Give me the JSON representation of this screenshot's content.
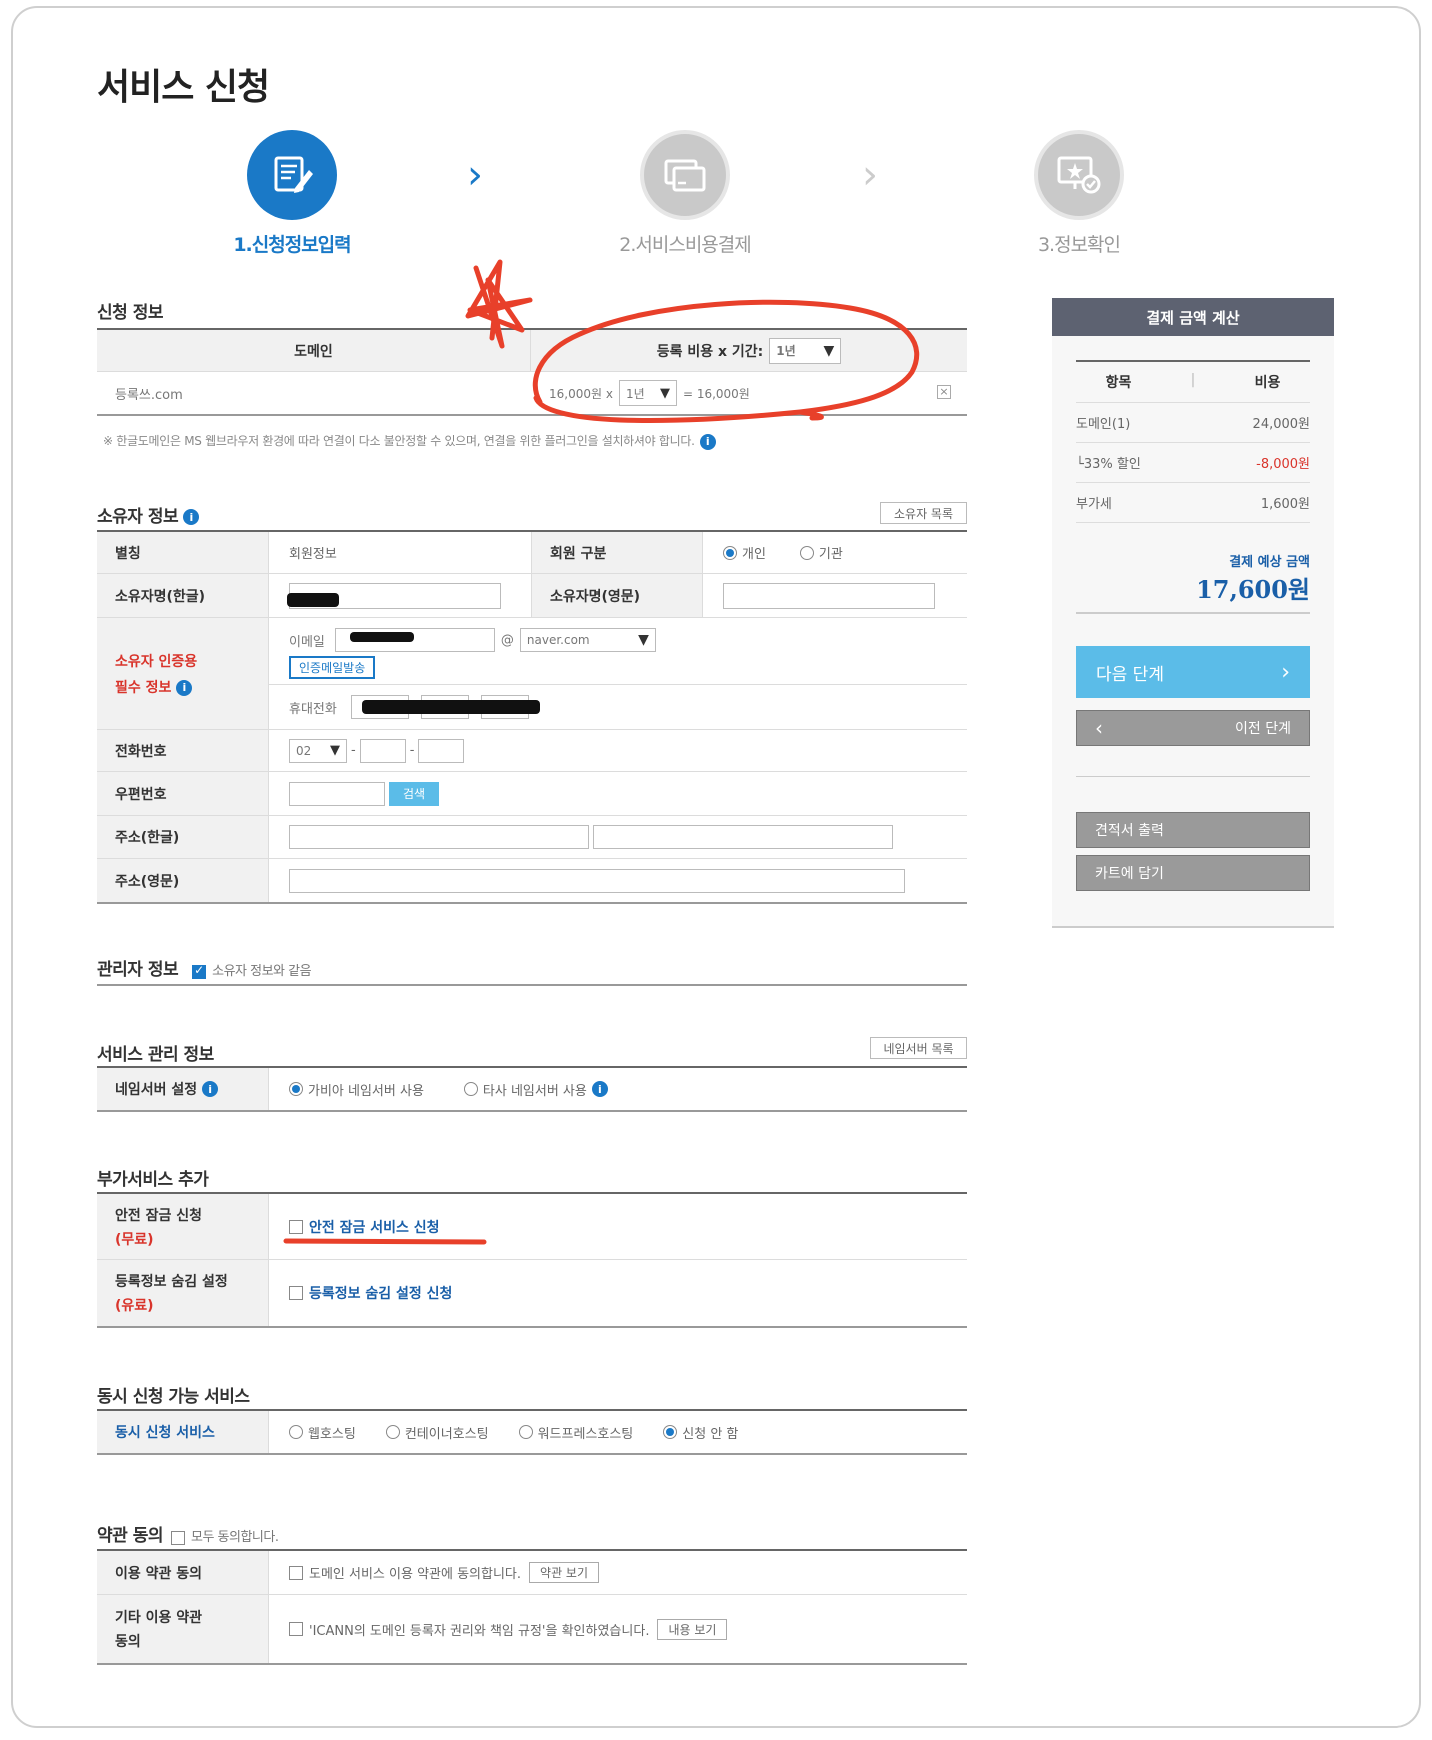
{
  "page_title": "서비스 신청",
  "steps": [
    {
      "label": "1.신청정보입력"
    },
    {
      "label": "2.서비스비용결제"
    },
    {
      "label": "3.정보확인"
    }
  ],
  "application": {
    "title": "신청 정보",
    "col_domain": "도메인",
    "col_fee": "등록 비용 x 기간:",
    "period_header_value": "1년",
    "domain_value": "등록쓰.com",
    "fee_text": "16,000원 x",
    "period_value": "1년",
    "total_text": "= 16,000원",
    "remove_icon": "×",
    "notice": "※ 한글도메인은 MS 웹브라우저 환경에 따라 연결이 다소 불안정할 수 있으며, 연결을 위한 플러그인을 설치하셔야 합니다."
  },
  "owner": {
    "title": "소유자 정보",
    "list_button": "소유자 목록",
    "nickname_label": "별칭",
    "nickname_value": "회원정보",
    "member_type_label": "회원 구분",
    "type_personal": "개인",
    "type_org": "기관",
    "name_ko_label": "소유자명(한글)",
    "name_en_label": "소유자명(영문)",
    "auth_label_1": "소유자 인증용",
    "auth_label_2": "필수 정보",
    "email_label": "이메일",
    "email_at": "@",
    "email_domain": "naver.com",
    "verify_button": "인증메일발송",
    "mobile_label": "휴대전화",
    "phone_label": "전화번호",
    "phone_prefix": "02",
    "dash": "-",
    "zip_label": "우편번호",
    "zip_button": "검색",
    "addr_ko_label": "주소(한글)",
    "addr_en_label": "주소(영문)"
  },
  "admin": {
    "title": "관리자 정보",
    "same_as_owner": "소유자 정보와 같음"
  },
  "service_mgmt": {
    "title": "서비스 관리 정보",
    "ns_list_button": "네임서버 목록",
    "ns_label": "네임서버 설정",
    "ns_gabia": "가비아 네임서버 사용",
    "ns_other": "타사 네임서버 사용"
  },
  "addons": {
    "title": "부가서비스 추가",
    "lock_label_1": "안전 잠금 신청",
    "lock_label_2": "(무료)",
    "lock_link": "안전 잠금 서비스 신청",
    "hide_label_1": "등록정보 숨김 설정",
    "hide_label_2": "(유료)",
    "hide_link": "등록정보 숨김 설정 신청"
  },
  "concurrent": {
    "title": "동시 신청 가능 서비스",
    "label": "동시 신청 서비스",
    "opt_web": "웹호스팅",
    "opt_container": "컨테이너호스팅",
    "opt_wp": "워드프레스호스팅",
    "opt_none": "신청 안 함"
  },
  "terms": {
    "title": "약관 동의",
    "agree_all": "모두 동의합니다.",
    "usage_label": "이용 약관 동의",
    "usage_text": "도메인 서비스 이용 약관에 동의합니다.",
    "usage_button": "약관 보기",
    "other_label_1": "기타 이용 약관",
    "other_label_2": "동의",
    "other_text": "'ICANN의 도메인 등록자 권리와 책임 규정'을 확인하였습니다.",
    "other_button": "내용 보기"
  },
  "payment": {
    "title": "결제 금액 계산",
    "col_item": "항목",
    "col_sep": "|",
    "col_cost": "비용",
    "rows": [
      {
        "item": "도메인(1)",
        "cost": "24,000원"
      },
      {
        "item": "└33% 할인",
        "cost": "-8,000원"
      },
      {
        "item": "부가세",
        "cost": "1,600원"
      }
    ],
    "expected_label": "결제 예상 금액",
    "expected_value": "17,600원",
    "next_button": "다음 단계",
    "prev_button": "이전 단계",
    "quote_button": "견적서 출력",
    "cart_button": "카트에 담기"
  },
  "colors": {
    "accent": "#1a79c7",
    "annotation": "#e8402a",
    "panel_header": "#5d6271",
    "next_button": "#5bbce8"
  }
}
